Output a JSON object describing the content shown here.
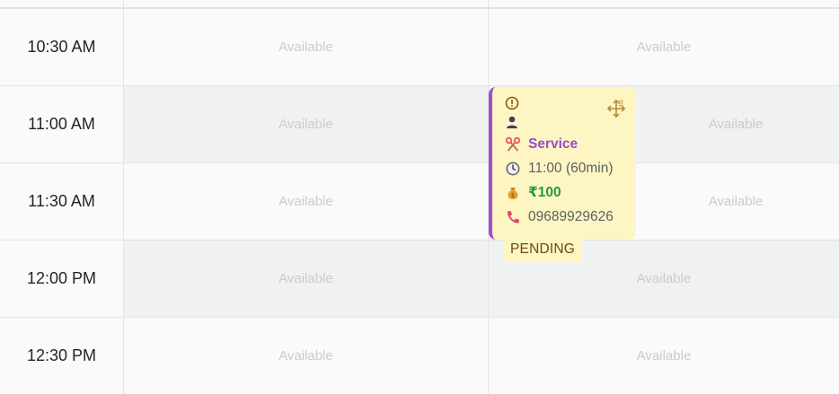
{
  "times": [
    "10:30 AM",
    "11:00 AM",
    "11:30 AM",
    "12:00 PM",
    "12:30 PM"
  ],
  "slot_label": "Available",
  "appointment": {
    "service": "Service",
    "time": "11:00 (60min)",
    "price": "₹100",
    "phone": "09689929626",
    "status": "PENDING",
    "accent_color": "#a04fcf",
    "background_color": "#fdf6c3",
    "icons": [
      "alert-circle-icon",
      "user-icon",
      "scissors-icon",
      "clock-icon",
      "money-bag-icon",
      "phone-icon",
      "move-icon"
    ]
  }
}
